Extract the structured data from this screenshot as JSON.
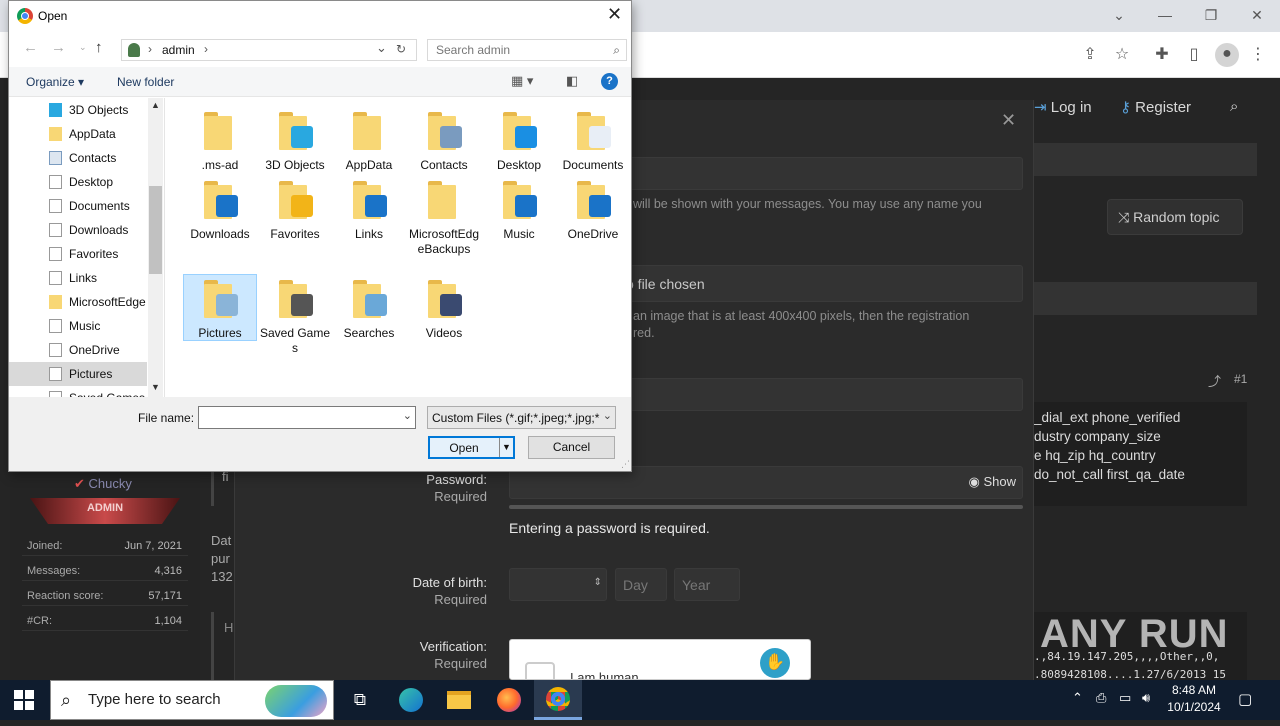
{
  "browser": {
    "window_controls": {
      "chevron": "⌄",
      "minimize": "—",
      "restore": "❐",
      "close": "✕"
    }
  },
  "forum": {
    "login_label": "Log in",
    "register_label": "Register",
    "random_topic_label": "Random topic",
    "modal_close": "✕",
    "name_hint": "will be shown with your messages. You may use any name you",
    "file_chosen": "o file chosen",
    "avatar_hint_line1": "an image that is at least 400x400 pixels, then the registration",
    "avatar_hint_line2": "red.",
    "password_label": "Password:",
    "password_required": "Required",
    "show_label": "Show",
    "password_error": "Entering a password is required.",
    "dob_label": "Date of birth:",
    "dob_required": "Required",
    "dob_day_placeholder": "Day",
    "dob_year_placeholder": "Year",
    "verification_label": "Verification:",
    "verification_required": "Required",
    "captcha_label": "I am human",
    "post_number": "#1",
    "code_lines": [
      "_dial_ext phone_verified",
      "dustry company_size",
      "e hq_zip hq_country",
      "do_not_call first_qa_date"
    ],
    "bottom_code_lines": [
      ".,84.19.147.205,,,,Other,,0,",
      ".8089428108....1.27/6/2013 15"
    ],
    "snippet_lines": [
      "Dat",
      "pur",
      "132"
    ],
    "snippet_lines2": [
      "fi",
      "H"
    ],
    "watermark": "ANY RUN"
  },
  "user_panel": {
    "username": "Chucky",
    "role_banner": "ADMIN",
    "stats": [
      {
        "key": "Joined:",
        "value": "Jun 7, 2021"
      },
      {
        "key": "Messages:",
        "value": "4,316"
      },
      {
        "key": "Reaction score:",
        "value": "57,171"
      },
      {
        "key": "#CR:",
        "value": "1,104"
      }
    ]
  },
  "dialog": {
    "title": "Open",
    "breadcrumb_root": "admin",
    "search_placeholder": "Search admin",
    "organize_label": "Organize",
    "new_folder_label": "New folder",
    "nav_items": [
      {
        "label": "3D Objects",
        "icon": "3d-objects-icon"
      },
      {
        "label": "AppData",
        "icon": "folder-icon"
      },
      {
        "label": "Contacts",
        "icon": "contacts-icon"
      },
      {
        "label": "Desktop",
        "icon": "desktop-icon"
      },
      {
        "label": "Documents",
        "icon": "documents-icon"
      },
      {
        "label": "Downloads",
        "icon": "downloads-icon"
      },
      {
        "label": "Favorites",
        "icon": "favorites-icon"
      },
      {
        "label": "Links",
        "icon": "links-icon"
      },
      {
        "label": "MicrosoftEdge",
        "icon": "folder-icon"
      },
      {
        "label": "Music",
        "icon": "music-icon"
      },
      {
        "label": "OneDrive",
        "icon": "onedrive-icon"
      },
      {
        "label": "Pictures",
        "icon": "pictures-icon",
        "selected": true
      },
      {
        "label": "Saved Games",
        "icon": "saved-games-icon"
      }
    ],
    "files": [
      {
        "label": ".ms-ad",
        "overlay": ""
      },
      {
        "label": "3D Objects",
        "overlay": "cube"
      },
      {
        "label": "AppData",
        "overlay": ""
      },
      {
        "label": "Contacts",
        "overlay": "contacts"
      },
      {
        "label": "Desktop",
        "overlay": "desktop"
      },
      {
        "label": "Documents",
        "overlay": "documents"
      },
      {
        "label": "Downloads",
        "overlay": "downloads"
      },
      {
        "label": "Favorites",
        "overlay": "star"
      },
      {
        "label": "Links",
        "overlay": "link"
      },
      {
        "label": "MicrosoftEdgeBackups",
        "overlay": ""
      },
      {
        "label": "Music",
        "overlay": "music"
      },
      {
        "label": "OneDrive",
        "overlay": "cloud"
      },
      {
        "label": "Pictures",
        "overlay": "pictures",
        "selected": true
      },
      {
        "label": "Saved Games",
        "overlay": "chess"
      },
      {
        "label": "Searches",
        "overlay": "search"
      },
      {
        "label": "Videos",
        "overlay": "film"
      }
    ],
    "file_name_label": "File name:",
    "file_name_value": "",
    "filter_value": "Custom Files (*.gif;*.jpeg;*.jpg;*",
    "open_label": "Open",
    "cancel_label": "Cancel"
  },
  "taskbar": {
    "search_placeholder": "Type here to search",
    "time": "8:48 AM",
    "date": "10/1/2024"
  },
  "colors": {
    "accent_blue": "#0078d7",
    "folder_yellow": "#f8d775",
    "forum_bg": "#252525",
    "taskbar_bg": "#0f1c2e"
  }
}
